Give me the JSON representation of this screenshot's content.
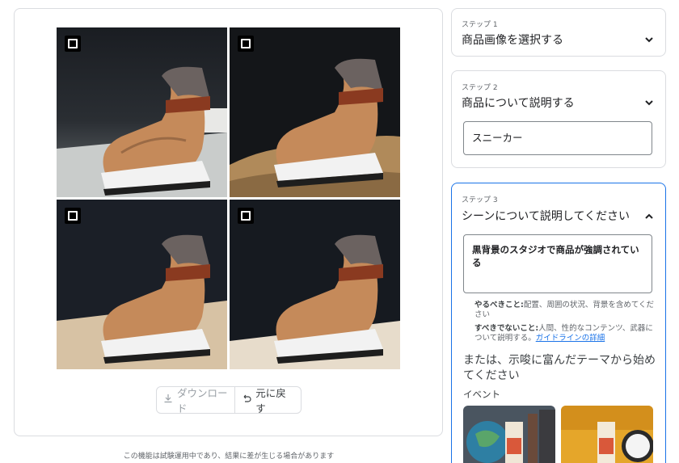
{
  "image_grid": {
    "tiles": [
      {
        "name": "sneaker-on-white-block",
        "selected": false
      },
      {
        "name": "sneaker-on-rock",
        "selected": false
      },
      {
        "name": "sneaker-on-beige-pedestal",
        "selected": false
      },
      {
        "name": "sneaker-on-cream-floor",
        "selected": false
      }
    ]
  },
  "actions": {
    "download_label": "ダウンロード",
    "download_icon": "download-icon",
    "undo_label": "元に戻す",
    "undo_icon": "undo-icon"
  },
  "footnote": "この機能は試験運用中であり、結果に差が生じる場合があります",
  "steps": [
    {
      "label": "ステップ 1",
      "title": "商品画像を選択する",
      "expanded": false
    },
    {
      "label": "ステップ 2",
      "title": "商品について説明する",
      "expanded": true,
      "input_value": "スニーカー"
    },
    {
      "label": "ステップ 3",
      "title": "シーンについて説明してください",
      "expanded": true,
      "textarea_value": "黒背景のスタジオで商品が強調されている",
      "hint_do_label": "やるべきこと:",
      "hint_do_text": "配置、周囲の状況、背景を含めてください",
      "hint_dont_label": "すべきでないこと:",
      "hint_dont_text": "人間、性的なコンテンツ、武器について説明する。",
      "guideline_link": "ガイドラインの詳細",
      "theme_lead": "または、示唆に富んだテーマから始めてください",
      "theme_category": "イベント"
    }
  ],
  "colors": {
    "accent": "#1a73e8",
    "border": "#dadce0"
  }
}
